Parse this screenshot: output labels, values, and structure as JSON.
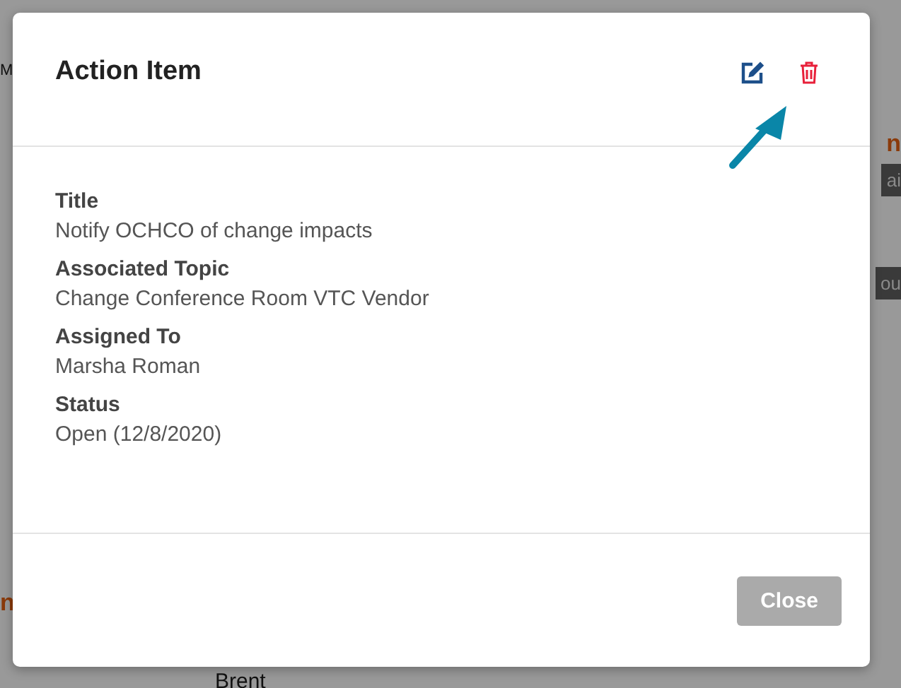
{
  "background": {
    "fragments": [
      {
        "kind": "plain",
        "text": "M"
      },
      {
        "kind": "link",
        "text": "n"
      },
      {
        "kind": "tag",
        "text": "ai"
      },
      {
        "kind": "tag",
        "text": "ou"
      },
      {
        "kind": "link",
        "text": "n"
      },
      {
        "kind": "plain",
        "text": "Brent"
      }
    ]
  },
  "dialog": {
    "title": "Action Item",
    "fields": [
      {
        "label": "Title",
        "value": "Notify OCHCO of change impacts"
      },
      {
        "label": "Associated Topic",
        "value": "Change Conference Room VTC Vendor"
      },
      {
        "label": "Assigned To",
        "value": "Marsha Roman"
      },
      {
        "label": "Status",
        "value": "Open (12/8/2020)"
      }
    ],
    "buttons": [
      "Close"
    ]
  }
}
